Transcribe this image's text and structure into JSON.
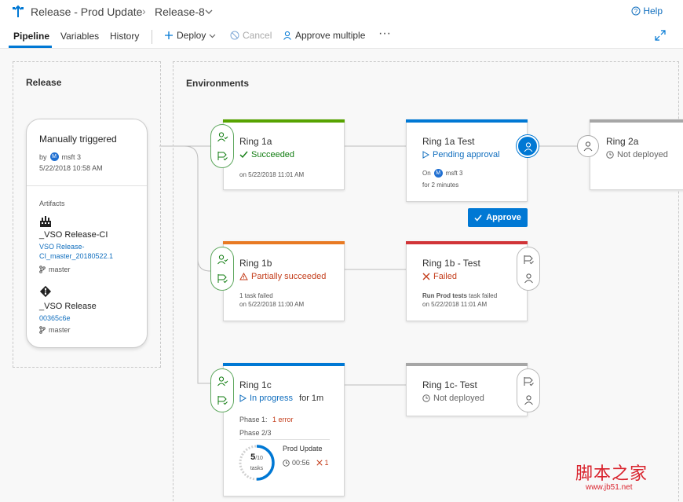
{
  "header": {
    "crumbs": [
      "Release - Prod Update",
      "Release-8"
    ],
    "help_label": "Help"
  },
  "toolbar": {
    "tabs": [
      "Pipeline",
      "Variables",
      "History"
    ],
    "deploy_label": "Deploy",
    "cancel_label": "Cancel",
    "approve_multiple_label": "Approve multiple"
  },
  "release_panel": {
    "title": "Release",
    "trigger": "Manually triggered",
    "by_label": "by",
    "avatar_letter": "M",
    "user": "msft 3",
    "datetime": "5/22/2018 10:58 AM",
    "artifacts_label": "Artifacts",
    "artifacts": [
      {
        "name": "_VSO Release-CI",
        "version_line1": "VSO Release-",
        "version_line2": "CI_master_20180522.1",
        "branch": "master"
      },
      {
        "name": "_VSO Release",
        "version_line1": "00365c6e",
        "branch": "master"
      }
    ]
  },
  "environments_panel": {
    "title": "Environments",
    "approve_label": "Approve",
    "envs": [
      {
        "name": "Ring 1a",
        "status": "Succeeded",
        "detail": "on 5/22/2018 11:01 AM",
        "bar_color": "#57a300"
      },
      {
        "name": "Ring 1a Test",
        "status": "Pending approval",
        "on_label": "On",
        "user": "msft 3",
        "detail2": "for 2 minutes",
        "bar_color": "#0078d4"
      },
      {
        "name": "Ring 2a",
        "status": "Not deployed",
        "bar_color": "#a6a6a6"
      },
      {
        "name": "Ring 1b",
        "status": "Partially succeeded",
        "detail1": "1 task failed",
        "detail2": "on 5/22/2018 11:00 AM",
        "bar_color": "#e87a23"
      },
      {
        "name": "Ring 1b - Test",
        "status": "Failed",
        "detail1_bold": "Run Prod tests",
        "detail1_rest": " task failed",
        "detail2": "on 5/22/2018 11:01 AM",
        "bar_color": "#d13438"
      },
      {
        "name": "Ring 1c",
        "status": "In progress",
        "duration": "for 1m",
        "phase1_label": "Phase 1:",
        "phase1_error": "1 error",
        "phase2_label": "Phase 2/3",
        "progress_done": "5",
        "progress_total": "/10",
        "progress_unit": "tasks",
        "progress_fraction": 0.5,
        "job_name": "Prod Update",
        "job_time": "00:56",
        "job_errors": "1",
        "bar_color": "#0078d4"
      },
      {
        "name": "Ring 1c- Test",
        "status": "Not deployed",
        "bar_color": "#a6a6a6"
      }
    ]
  },
  "watermark": {
    "text": "脚本之家",
    "url": "www.jb51.net"
  }
}
